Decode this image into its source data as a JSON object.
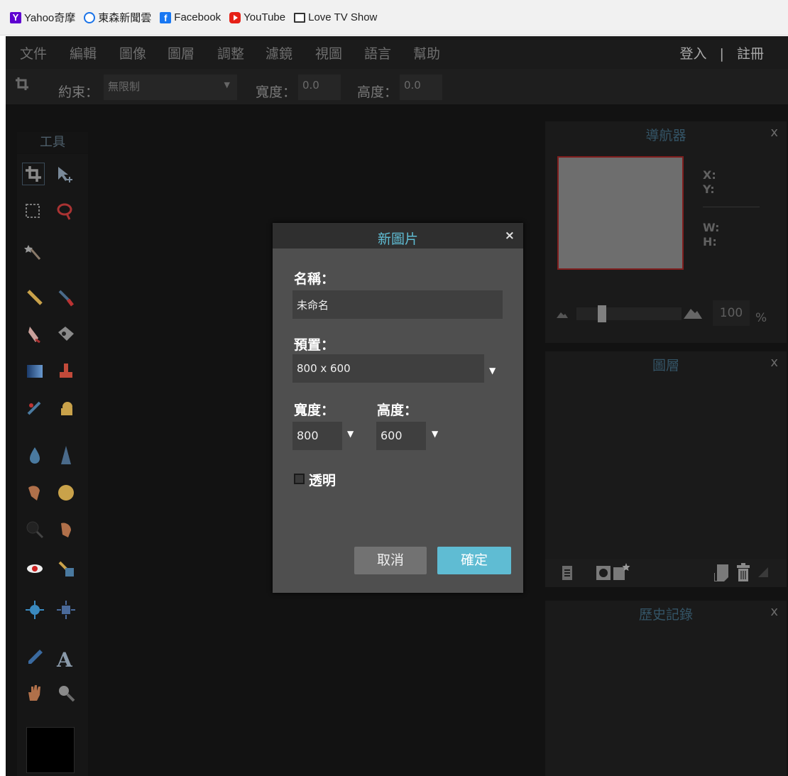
{
  "bookmarks": [
    {
      "label": "Yahoo奇摩",
      "icon": "yahoo-icon"
    },
    {
      "label": "東森新聞雲",
      "icon": "ettoday-icon"
    },
    {
      "label": "Facebook",
      "icon": "facebook-icon"
    },
    {
      "label": "YouTube",
      "icon": "youtube-icon"
    },
    {
      "label": "Love TV Show",
      "icon": "tv-icon"
    }
  ],
  "menu": {
    "items": [
      "文件",
      "編輯",
      "圖像",
      "圖層",
      "調整",
      "濾鏡",
      "視圖",
      "語言",
      "幫助"
    ],
    "login": "登入",
    "separator": "|",
    "register": "註冊"
  },
  "options": {
    "constraint_label": "約束：",
    "constraint_value": "無限制",
    "width_label": "寬度：",
    "width_value": "0.0",
    "height_label": "高度：",
    "height_value": "0.0"
  },
  "tools": {
    "title": "工具",
    "items": [
      "crop-icon",
      "move-icon",
      "marquee-icon",
      "lasso-icon",
      "magic-wand-icon",
      "pencil-icon",
      "brush-icon",
      "eraser-icon",
      "fill-icon",
      "gradient-icon",
      "stamp-icon",
      "spot-heal-icon",
      "sponge-icon",
      "blur-icon",
      "sharpen-icon",
      "smudge-icon",
      "dodge-icon",
      "burn-icon",
      "zoom-lens-icon",
      "red-eye-icon",
      "color-replace-icon",
      "bloat-icon",
      "pinch-icon",
      "eyedropper-icon",
      "text-icon",
      "hand-icon",
      "zoom-icon"
    ],
    "text_tool_glyph": "A"
  },
  "navigator": {
    "title": "導航器",
    "close": "x",
    "x_label": "X:",
    "y_label": "Y:",
    "w_label": "W:",
    "h_label": "H:",
    "zoom": "100",
    "zoom_unit": "%",
    "zoom_slider_fraction": 0.2
  },
  "layers": {
    "title": "圖層",
    "close": "x"
  },
  "history": {
    "title": "歷史記錄",
    "close": "x"
  },
  "modal": {
    "title": "新圖片",
    "close": "×",
    "name_label": "名稱：",
    "name_value": "未命名",
    "preset_label": "預置：",
    "preset_value": "800 x 600",
    "width_label": "寬度：",
    "width_value": "800",
    "height_label": "高度：",
    "height_value": "600",
    "transparent_label": "透明",
    "transparent_checked": false,
    "cancel": "取消",
    "ok": "確定"
  },
  "colors": {
    "accent": "#5fbcd3",
    "panel_bg": "#1a1a1a",
    "app_bg": "#121212",
    "modal_bg": "#4f4f4f"
  }
}
